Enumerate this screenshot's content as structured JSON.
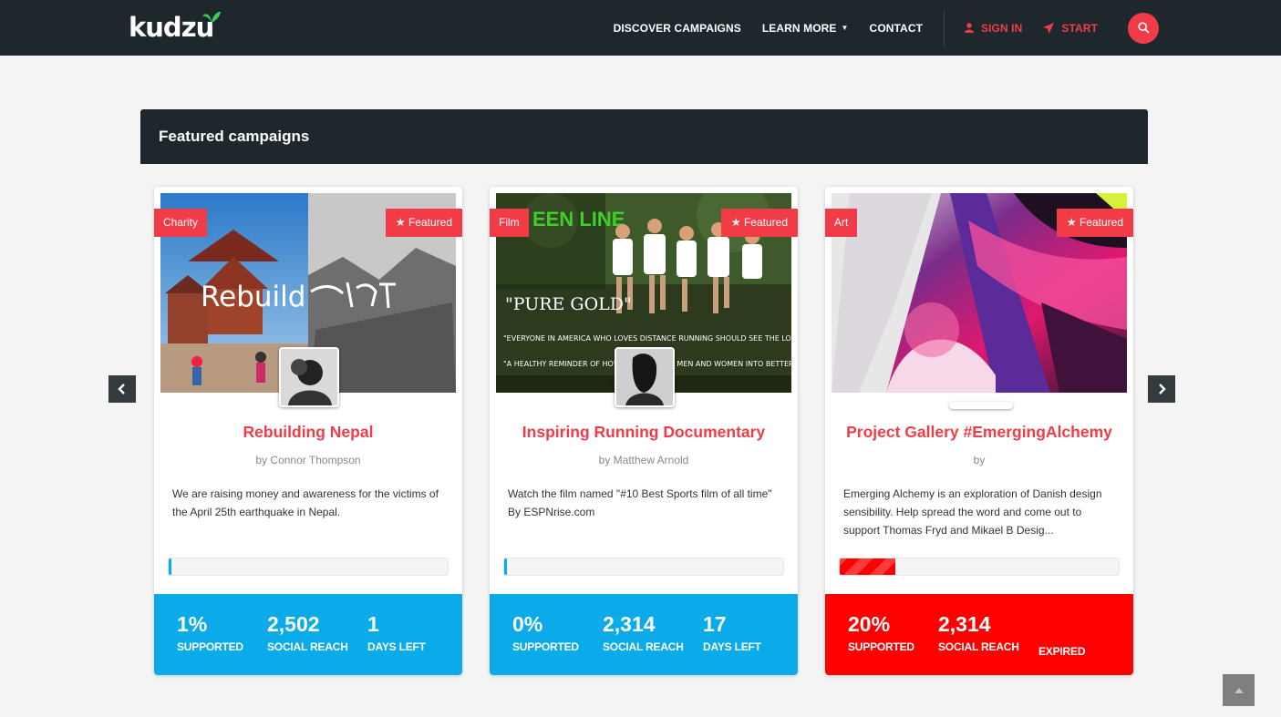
{
  "brand": {
    "name": "kudzu"
  },
  "nav": {
    "discover": "DISCOVER CAMPAIGNS",
    "learn_more": "LEARN MORE",
    "contact": "CONTACT",
    "sign_in": "SIGN IN",
    "start": "START"
  },
  "section": {
    "title": "Featured campaigns"
  },
  "campaigns": [
    {
      "category": "Charity",
      "featured": "Featured",
      "title": "Rebuilding Nepal",
      "author": "by Connor Thompson",
      "description": "We are raising money and awareness for the victims of the April 25th earthquake in Nepal.",
      "image_text": "Rebuild",
      "progress": 1,
      "supported": "1%",
      "supported_label": "SUPPORTED",
      "reach": "2,502",
      "reach_label": "SOCIAL REACH",
      "days": "1",
      "days_label": "DAYS LEFT",
      "stats_color": "#0aabe8"
    },
    {
      "category": "Film",
      "featured": "Featured",
      "title": "Inspiring Running Documentary",
      "author": "by Matthew Arnold",
      "description": "Watch the film named \"#10 Best Sports film of all time\" By ESPNrise.com",
      "image_text": "\"PURE GOLD\"",
      "progress": 0,
      "supported": "0%",
      "supported_label": "SUPPORTED",
      "reach": "2,314",
      "reach_label": "SOCIAL REACH",
      "days": "17",
      "days_label": "DAYS LEFT",
      "stats_color": "#0aabe8"
    },
    {
      "category": "Art",
      "featured": "Featured",
      "title": "Project Gallery #EmergingAlchemy",
      "author": "by",
      "description": "Emerging Alchemy is an exploration of Danish design sensibility. Help spread the word and come out to support Thomas Fryd and Mikael B Desig...",
      "progress": 20,
      "supported": "20%",
      "supported_label": "SUPPORTED",
      "reach": "2,314",
      "reach_label": "SOCIAL REACH",
      "days_label": "EXPIRED",
      "stats_color": "#ff0000"
    }
  ],
  "colors": {
    "accent": "#f13c48",
    "nav_bg": "#1e282c",
    "stats_blue": "#0aabe8",
    "stats_red": "#ff0000"
  },
  "icons": {
    "search": "search-icon",
    "user": "user-icon",
    "rocket": "rocket-icon",
    "star": "star-icon",
    "prev": "chevron-left-icon",
    "next": "chevron-right-icon",
    "top": "chevron-up-icon"
  }
}
